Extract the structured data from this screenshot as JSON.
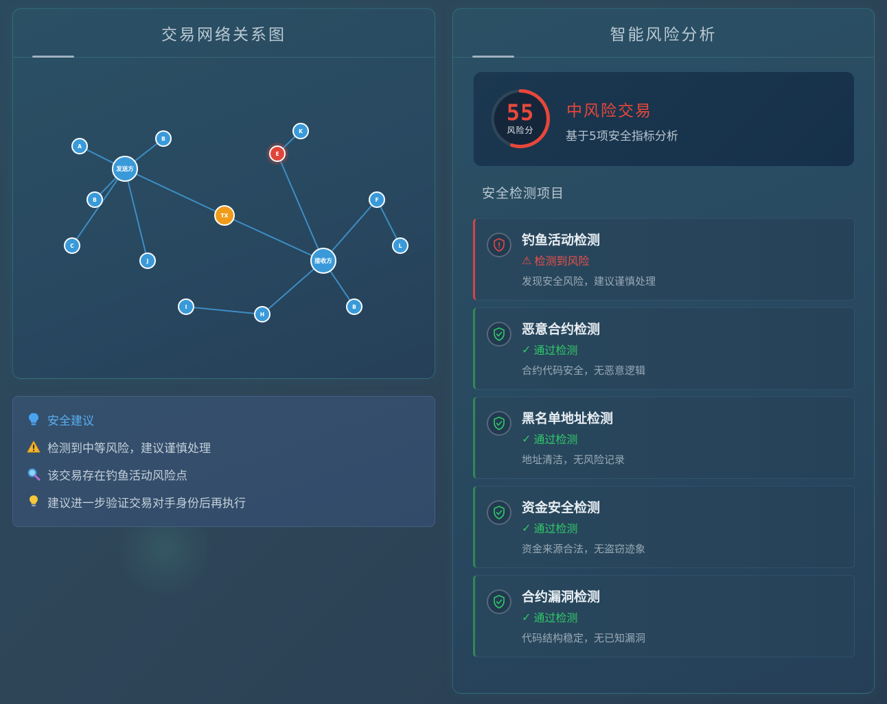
{
  "network_panel": {
    "title": "交易网络关系图",
    "nodes": [
      {
        "id": "sender",
        "label": "发送方"
      },
      {
        "id": "receiver",
        "label": "接收方"
      },
      {
        "id": "tx",
        "label": "TX"
      },
      {
        "id": "A",
        "label": "A"
      },
      {
        "id": "B1",
        "label": "B"
      },
      {
        "id": "B2",
        "label": "B"
      },
      {
        "id": "C",
        "label": "C"
      },
      {
        "id": "J",
        "label": "J"
      },
      {
        "id": "E",
        "label": "E"
      },
      {
        "id": "K",
        "label": "K"
      },
      {
        "id": "F",
        "label": "F"
      },
      {
        "id": "L",
        "label": "L"
      },
      {
        "id": "I",
        "label": "I"
      },
      {
        "id": "H",
        "label": "H"
      },
      {
        "id": "B3",
        "label": "B"
      }
    ],
    "colors": {
      "normal": "#3a9ad9",
      "tx": "#f09b1a",
      "risk": "#e0453a",
      "edge": "#3d8ec4"
    }
  },
  "advice": {
    "title": "安全建议",
    "items": [
      {
        "icon": "warning-icon",
        "text": "检测到中等风险，建议谨慎处理"
      },
      {
        "icon": "magnifier-icon",
        "text": "该交易存在钓鱼活动风险点"
      },
      {
        "icon": "lightbulb-icon",
        "text": "建议进一步验证交易对手身份后再执行"
      }
    ]
  },
  "risk_panel": {
    "title": "智能风险分析",
    "score": "55",
    "score_label": "风险分",
    "score_value": 55,
    "score_max": 100,
    "risk_level": "中风险交易",
    "risk_sub": "基于5项安全指标分析",
    "section_title": "安全检测项目",
    "checks": [
      {
        "name": "钓鱼活动检测",
        "status": "检测到风险",
        "status_type": "bad",
        "symbol": "⚠",
        "desc": "发现安全风险，建议谨慎处理"
      },
      {
        "name": "恶意合约检测",
        "status": "通过检测",
        "status_type": "ok",
        "symbol": "✓",
        "desc": "合约代码安全，无恶意逻辑"
      },
      {
        "name": "黑名单地址检测",
        "status": "通过检测",
        "status_type": "ok",
        "symbol": "✓",
        "desc": "地址清洁，无风险记录"
      },
      {
        "name": "资金安全检测",
        "status": "通过检测",
        "status_type": "ok",
        "symbol": "✓",
        "desc": "资金来源合法，无盗窃迹象"
      },
      {
        "name": "合约漏洞检测",
        "status": "通过检测",
        "status_type": "ok",
        "symbol": "✓",
        "desc": "代码结构稳定，无已知漏洞"
      }
    ],
    "colors": {
      "danger": "#e8473a",
      "ok": "#2fc968"
    }
  }
}
